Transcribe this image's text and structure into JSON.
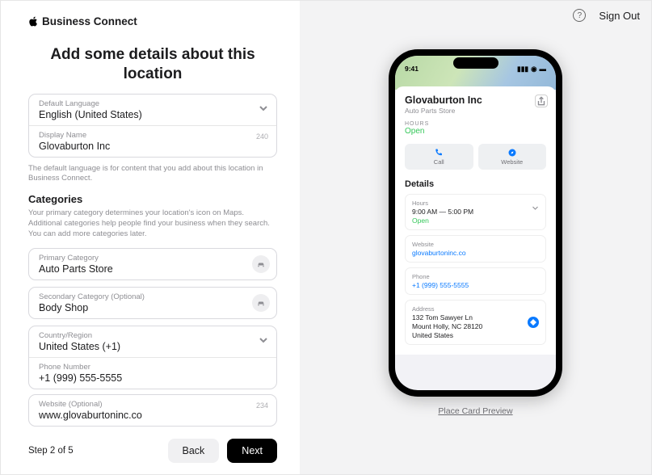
{
  "header": {
    "brand": "Business Connect",
    "signout": "Sign Out"
  },
  "title": "Add some details about this location",
  "language": {
    "label": "Default Language",
    "value": "English (United States)"
  },
  "displayName": {
    "label": "Display Name",
    "value": "Glovaburton Inc",
    "count": "240"
  },
  "note": "The default language is for content that you add about this location in Business Connect.",
  "categories": {
    "title": "Categories",
    "desc": "Your primary category determines your location's icon on Maps. Additional categories help people find your business when they search. You can add more categories later.",
    "primary": {
      "label": "Primary Category",
      "value": "Auto Parts Store"
    },
    "secondary": {
      "label": "Secondary Category (Optional)",
      "value": "Body Shop"
    }
  },
  "country": {
    "label": "Country/Region",
    "value": "United States (+1)"
  },
  "phone": {
    "label": "Phone Number",
    "value": "+1 (999) 555-5555"
  },
  "website": {
    "label": "Website (Optional)",
    "value": "www.glovaburtoninc.co",
    "count": "234"
  },
  "footer": {
    "step": "Step 2 of 5",
    "back": "Back",
    "next": "Next"
  },
  "preview": {
    "time": "9:41",
    "bizName": "Glovaburton Inc",
    "bizSub": "Auto Parts Store",
    "hoursLabel": "HOURS",
    "open": "Open",
    "call": "Call",
    "websiteBtn": "Website",
    "detailsTitle": "Details",
    "rows": {
      "hours": {
        "label": "Hours",
        "value": "9:00 AM — 5:00 PM",
        "status": "Open"
      },
      "website": {
        "label": "Website",
        "value": "glovaburtoninc.co"
      },
      "phone": {
        "label": "Phone",
        "value": "+1 (999) 555-5555"
      },
      "address": {
        "label": "Address",
        "line1": "132 Tom Sawyer Ln",
        "line2": "Mount Holly, NC 28120",
        "line3": "United States"
      }
    },
    "caption": "Place Card Preview"
  }
}
